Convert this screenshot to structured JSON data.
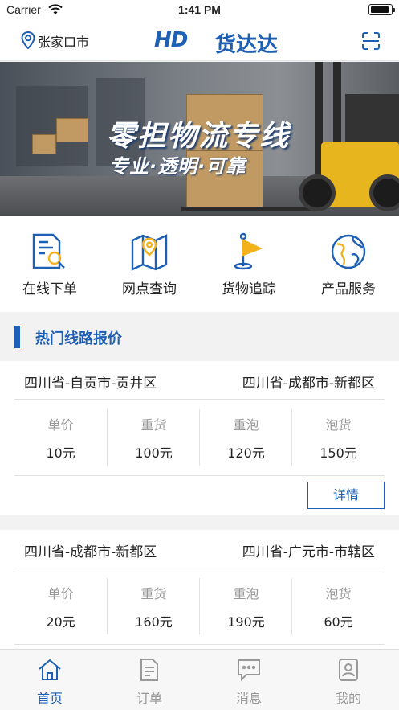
{
  "status_bar": {
    "carrier": "Carrier",
    "time": "1:41 PM",
    "battery_level": 0.95
  },
  "header": {
    "location": "张家口市",
    "logo_mark": "HD",
    "logo_text": "货达达",
    "icons": {
      "location": "location-pin-icon",
      "scan": "scan-icon"
    }
  },
  "banner": {
    "title": "零担物流专线",
    "subtitle": "专业·透明·可靠"
  },
  "quick_menu": [
    {
      "label": "在线下单",
      "icon": "document-search-icon"
    },
    {
      "label": "网点查询",
      "icon": "map-pin-icon"
    },
    {
      "label": "货物追踪",
      "icon": "flag-icon"
    },
    {
      "label": "产品服务",
      "icon": "globe-icon"
    }
  ],
  "hot_routes": {
    "title": "热门线路报价",
    "detail_label": "详情",
    "price_labels": [
      "单价",
      "重货",
      "重泡",
      "泡货"
    ],
    "routes": [
      {
        "from": "四川省-自贡市-贡井区",
        "to": "四川省-成都市-新都区",
        "prices": [
          "10元",
          "100元",
          "120元",
          "150元"
        ]
      },
      {
        "from": "四川省-成都市-新都区",
        "to": "四川省-广元市-市辖区",
        "prices": [
          "20元",
          "160元",
          "190元",
          "60元"
        ]
      }
    ]
  },
  "tab_bar": {
    "active": "首页",
    "tabs": [
      {
        "label": "首页",
        "icon": "home-icon"
      },
      {
        "label": "订单",
        "icon": "order-icon"
      },
      {
        "label": "消息",
        "icon": "message-icon"
      },
      {
        "label": "我的",
        "icon": "profile-icon"
      }
    ]
  },
  "colors": {
    "brand": "#1d5fb4",
    "muted": "#999999",
    "background": "#f2f2f2",
    "accent_yellow": "#f3b21b"
  }
}
